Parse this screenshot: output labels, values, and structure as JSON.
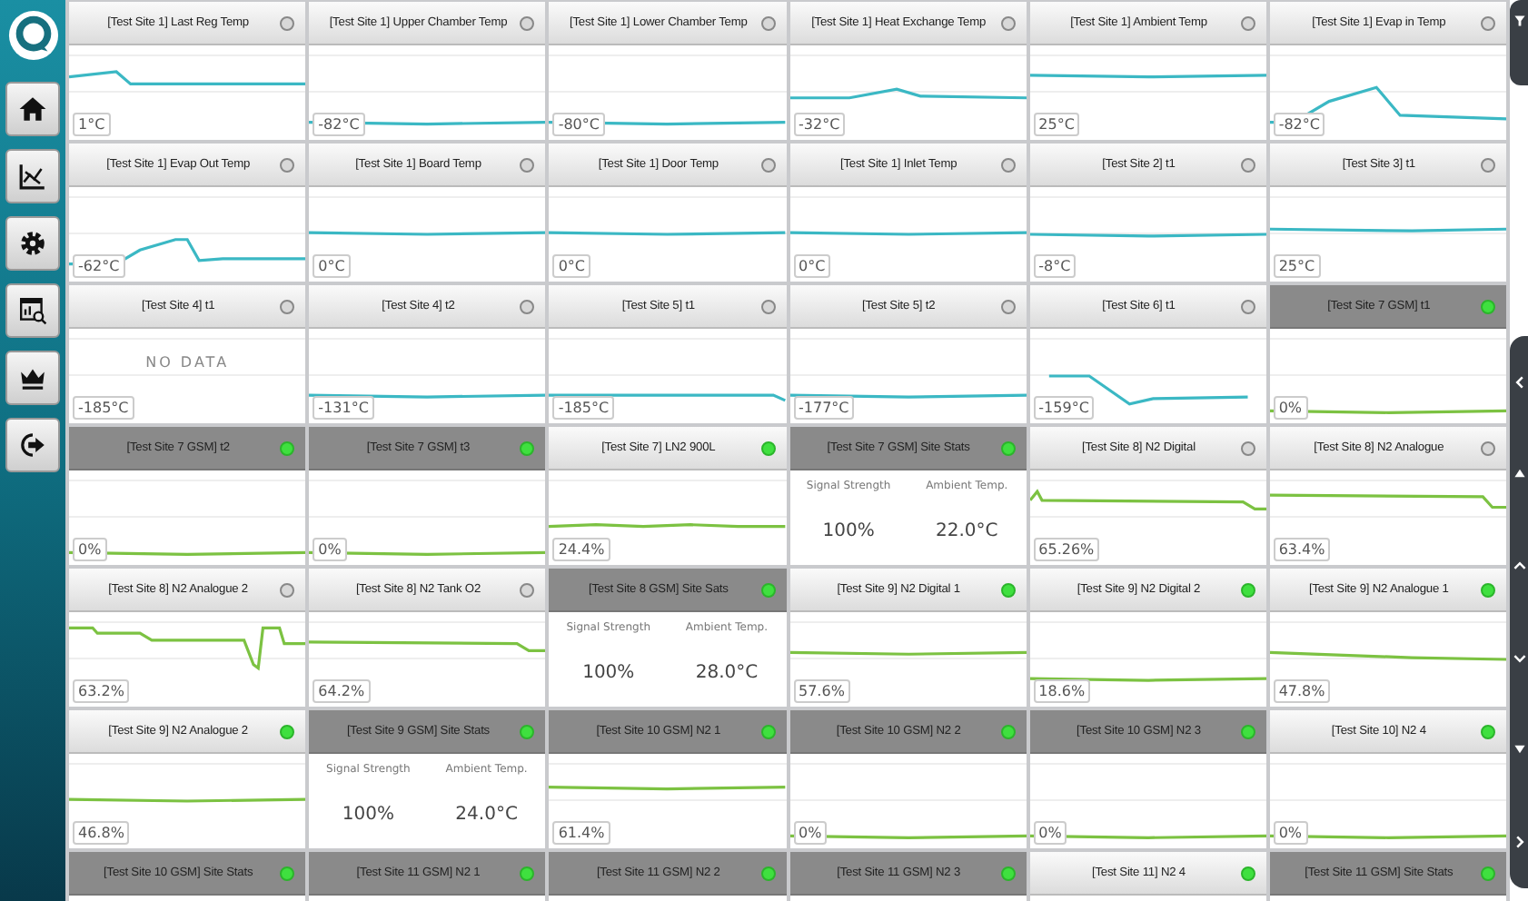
{
  "tiles": [
    {
      "title": "[Test Site 1] Last Reg Temp",
      "highlighted": false,
      "online": false,
      "kind": "chart",
      "color": "#3bb8c4",
      "reading": "1°C"
    },
    {
      "title": "[Test Site 1] Upper Chamber Temp",
      "highlighted": false,
      "online": false,
      "kind": "chart",
      "color": "#3bb8c4",
      "reading": "-82°C"
    },
    {
      "title": "[Test Site 1] Lower Chamber Temp",
      "highlighted": false,
      "online": false,
      "kind": "chart",
      "color": "#3bb8c4",
      "reading": "-80°C"
    },
    {
      "title": "[Test Site 1] Heat Exchange Temp",
      "highlighted": false,
      "online": false,
      "kind": "chart",
      "color": "#3bb8c4",
      "reading": "-32°C"
    },
    {
      "title": "[Test Site 1] Ambient Temp",
      "highlighted": false,
      "online": false,
      "kind": "chart",
      "color": "#3bb8c4",
      "reading": "25°C"
    },
    {
      "title": "[Test Site 1] Evap in Temp",
      "highlighted": false,
      "online": false,
      "kind": "chart",
      "color": "#3bb8c4",
      "reading": "-82°C"
    },
    {
      "title": "[Test Site 1] Evap Out Temp",
      "highlighted": false,
      "online": false,
      "kind": "chart",
      "color": "#3bb8c4",
      "reading": "-62°C"
    },
    {
      "title": "[Test Site 1] Board Temp",
      "highlighted": false,
      "online": false,
      "kind": "chart",
      "color": "#3bb8c4",
      "reading": "0°C"
    },
    {
      "title": "[Test Site 1] Door Temp",
      "highlighted": false,
      "online": false,
      "kind": "chart",
      "color": "#3bb8c4",
      "reading": "0°C"
    },
    {
      "title": "[Test Site 1] Inlet Temp",
      "highlighted": false,
      "online": false,
      "kind": "chart",
      "color": "#3bb8c4",
      "reading": "0°C"
    },
    {
      "title": "[Test Site 2] t1",
      "highlighted": false,
      "online": false,
      "kind": "chart",
      "color": "#3bb8c4",
      "reading": "-8°C"
    },
    {
      "title": "[Test Site 3] t1",
      "highlighted": false,
      "online": false,
      "kind": "chart",
      "color": "#3bb8c4",
      "reading": "25°C"
    },
    {
      "title": "[Test Site 4] t1",
      "highlighted": false,
      "online": false,
      "kind": "nodata",
      "message": "NO DATA",
      "reading": "-185°C"
    },
    {
      "title": "[Test Site 4] t2",
      "highlighted": false,
      "online": false,
      "kind": "chart",
      "color": "#3bb8c4",
      "reading": "-131°C"
    },
    {
      "title": "[Test Site 5] t1",
      "highlighted": false,
      "online": false,
      "kind": "chart",
      "color": "#3bb8c4",
      "reading": "-185°C"
    },
    {
      "title": "[Test Site 5] t2",
      "highlighted": false,
      "online": false,
      "kind": "chart",
      "color": "#3bb8c4",
      "reading": "-177°C"
    },
    {
      "title": "[Test Site 6] t1",
      "highlighted": false,
      "online": false,
      "kind": "chart",
      "color": "#3bb8c4",
      "reading": "-159°C"
    },
    {
      "title": "[Test Site 7 GSM] t1",
      "highlighted": true,
      "online": true,
      "kind": "chart",
      "color": "#7cc242",
      "reading": "0%"
    },
    {
      "title": "[Test Site 7 GSM] t2",
      "highlighted": true,
      "online": true,
      "kind": "chart",
      "color": "#7cc242",
      "reading": "0%"
    },
    {
      "title": "[Test Site 7 GSM] t3",
      "highlighted": true,
      "online": true,
      "kind": "chart",
      "color": "#7cc242",
      "reading": "0%"
    },
    {
      "title": "[Test Site 7] LN2 900L",
      "highlighted": false,
      "online": true,
      "kind": "chart",
      "color": "#7cc242",
      "reading": "24.4%"
    },
    {
      "title": "[Test Site 7 GSM] Site Stats",
      "highlighted": true,
      "online": true,
      "kind": "stats",
      "stats": [
        {
          "label": "Signal Strength",
          "value": "100%"
        },
        {
          "label": "Ambient Temp.",
          "value": "22.0°C"
        }
      ]
    },
    {
      "title": "[Test Site 8] N2 Digital",
      "highlighted": false,
      "online": false,
      "kind": "chart",
      "color": "#7cc242",
      "reading": "65.26%"
    },
    {
      "title": "[Test Site 8] N2 Analogue",
      "highlighted": false,
      "online": false,
      "kind": "chart",
      "color": "#7cc242",
      "reading": "63.4%"
    },
    {
      "title": "[Test Site 8] N2 Analogue 2",
      "highlighted": false,
      "online": false,
      "kind": "chart",
      "color": "#7cc242",
      "reading": "63.2%"
    },
    {
      "title": "[Test Site 8] N2 Tank O2",
      "highlighted": false,
      "online": false,
      "kind": "chart",
      "color": "#7cc242",
      "reading": "64.2%"
    },
    {
      "title": "[Test Site 8 GSM] Site Sats",
      "highlighted": true,
      "online": true,
      "kind": "stats",
      "stats": [
        {
          "label": "Signal Strength",
          "value": "100%"
        },
        {
          "label": "Ambient Temp.",
          "value": "28.0°C"
        }
      ]
    },
    {
      "title": "[Test Site 9] N2 Digital 1",
      "highlighted": false,
      "online": true,
      "kind": "chart",
      "color": "#7cc242",
      "reading": "57.6%"
    },
    {
      "title": "[Test Site 9] N2 Digital 2",
      "highlighted": false,
      "online": true,
      "kind": "chart",
      "color": "#7cc242",
      "reading": "18.6%"
    },
    {
      "title": "[Test Site 9] N2 Analogue 1",
      "highlighted": false,
      "online": true,
      "kind": "chart",
      "color": "#7cc242",
      "reading": "47.8%"
    },
    {
      "title": "[Test Site 9] N2 Analogue 2",
      "highlighted": false,
      "online": true,
      "kind": "chart",
      "color": "#7cc242",
      "reading": "46.8%"
    },
    {
      "title": "[Test Site 9 GSM] Site Stats",
      "highlighted": true,
      "online": true,
      "kind": "stats",
      "stats": [
        {
          "label": "Signal Strength",
          "value": "100%"
        },
        {
          "label": "Ambient Temp.",
          "value": "24.0°C"
        }
      ]
    },
    {
      "title": "[Test Site 10 GSM] N2 1",
      "highlighted": true,
      "online": true,
      "kind": "chart",
      "color": "#7cc242",
      "reading": "61.4%"
    },
    {
      "title": "[Test Site 10 GSM] N2 2",
      "highlighted": true,
      "online": true,
      "kind": "chart",
      "color": "#7cc242",
      "reading": "0%"
    },
    {
      "title": "[Test Site 10 GSM] N2 3",
      "highlighted": true,
      "online": true,
      "kind": "chart",
      "color": "#7cc242",
      "reading": "0%"
    },
    {
      "title": "[Test Site 10] N2 4",
      "highlighted": false,
      "online": true,
      "kind": "chart",
      "color": "#7cc242",
      "reading": "0%"
    },
    {
      "title": "[Test Site 10 GSM] Site Stats",
      "highlighted": true,
      "online": true,
      "kind": "header_only"
    },
    {
      "title": "[Test Site 11 GSM] N2 1",
      "highlighted": true,
      "online": true,
      "kind": "header_only"
    },
    {
      "title": "[Test Site 11 GSM] N2 2",
      "highlighted": true,
      "online": true,
      "kind": "header_only"
    },
    {
      "title": "[Test Site 11 GSM] N2 3",
      "highlighted": true,
      "online": true,
      "kind": "header_only"
    },
    {
      "title": "[Test Site 11] N2 4",
      "highlighted": false,
      "online": true,
      "kind": "header_only"
    },
    {
      "title": "[Test Site 11 GSM] Site Stats",
      "highlighted": true,
      "online": true,
      "kind": "header_only"
    }
  ]
}
